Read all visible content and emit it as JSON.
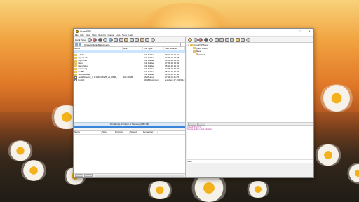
{
  "app": {
    "title": "CrossFTP"
  },
  "window_controls": {
    "minimize": "—",
    "maximize": "□",
    "close": "✕"
  },
  "menu": [
    "File",
    "Edit",
    "View",
    "Sites",
    "Security",
    "Queue",
    "Logs",
    "Tools",
    "Help"
  ],
  "left_pane": {
    "label": "Local Pane",
    "path": "C:\\Users\\daniel\\Documents",
    "columns": [
      "Name",
      "Size",
      "File Type",
      "Last Modified"
    ],
    "files": [
      {
        "name": "..",
        "size": "",
        "type": "",
        "modified": ""
      },
      {
        "name": "Adobe",
        "size": "",
        "type": "File Folder",
        "modified": "29.10.15 20:41"
      },
      {
        "name": "CyberLink",
        "size": "",
        "type": "File Folder",
        "modified": "17.08.15 10:58"
      },
      {
        "name": "My Fonts",
        "size": "",
        "type": "File Folder",
        "modified": "22.08.15 04:54"
      },
      {
        "name": "Nero",
        "size": "",
        "type": "File Folder",
        "modified": "17.08.15 10:59"
      },
      {
        "name": "NeroVideo",
        "size": "",
        "type": "File Folder",
        "modified": "05.10.15 21:41"
      },
      {
        "name": "Samsung",
        "size": "",
        "type": "File Folder",
        "modified": "22.08.15 15:23"
      },
      {
        "name": "SelfBit",
        "size": "",
        "type": "File Folder",
        "modified": "05.10.15 15:32"
      },
      {
        "name": "WebStorage",
        "size": "",
        "type": "File Folder",
        "modified": "22.08.15 17:38"
      },
      {
        "name": "AudioDirector_6.0.10404.5625_x0_OM0_...",
        "size": "106,38 kB",
        "type": "MeMeatup",
        "modified": "17.11.15 21:25"
      },
      {
        "name": "hosttxt",
        "size": "",
        "type": "1968 Document",
        "modified": "textdrew 17.10.15 12:34"
      }
    ],
    "status": "0 Folder(s), 0 File(s), 1 Selected (0B / 0B)",
    "progress_label": "Queued 0B / Total 0B"
  },
  "queue": {
    "columns": [
      "Name",
      "Size",
      "Progress",
      "Speed",
      "Remaining"
    ]
  },
  "right_pane": {
    "tree": [
      {
        "label": "CrossFTP Sites",
        "level": 0
      },
      {
        "label": "Quick History",
        "level": 1
      },
      {
        "label": "Sites",
        "level": 1
      },
      {
        "label": "Default",
        "level": 2
      }
    ],
    "log": [
      {
        "text": "CrossFTP 1.97.1",
        "color": "#b0309a"
      },
      {
        "text": "Secure random seed initialized.",
        "color": "#b0309a"
      }
    ],
    "footer": "Main"
  }
}
